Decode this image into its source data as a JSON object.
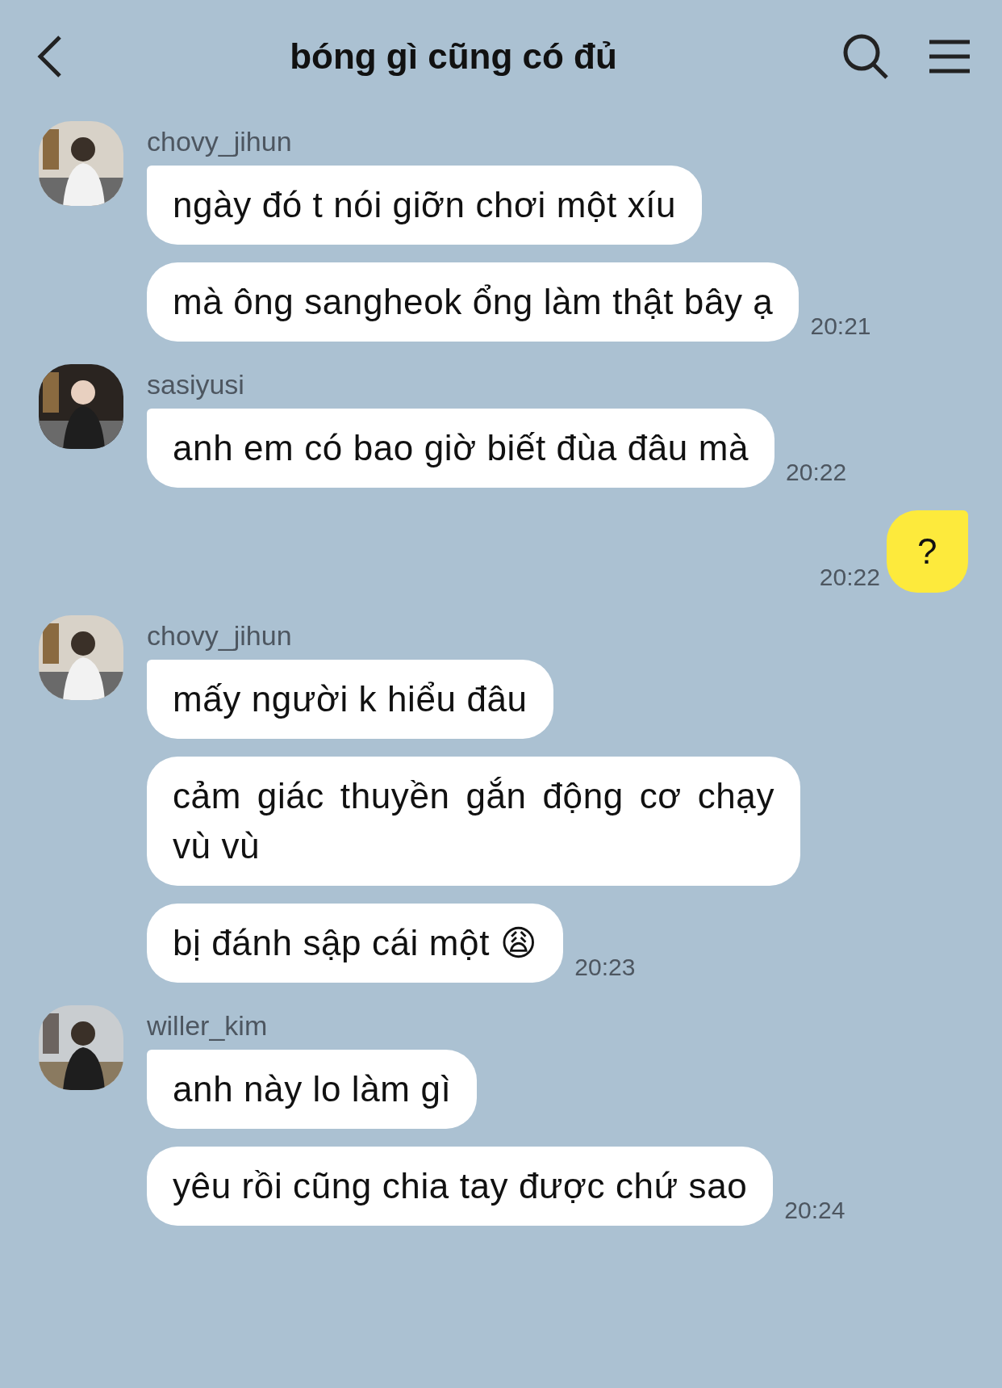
{
  "header": {
    "title": "bóng gì cũng có đủ"
  },
  "messages": [
    {
      "kind": "group",
      "sender": "chovy_jihun",
      "bubbles": [
        "ngày đó t nói giỡn chơi một xíu",
        "mà ông sangheok ổng làm thật bây ạ"
      ],
      "time": "20:21"
    },
    {
      "kind": "group",
      "sender": "sasiyusi",
      "bubbles": [
        "anh em có bao giờ biết đùa đâu mà"
      ],
      "time": "20:22"
    },
    {
      "kind": "own",
      "text": "?",
      "time": "20:22"
    },
    {
      "kind": "group",
      "sender": "chovy_jihun",
      "bubbles": [
        "mấy người k hiểu đâu",
        "cảm giác thuyền gắn động cơ chạy vù vù",
        "bị đánh sập cái một 😩"
      ],
      "time": "20:23"
    },
    {
      "kind": "group",
      "sender": "willer_kim",
      "bubbles": [
        "anh này lo làm gì",
        "yêu rồi cũng chia tay được chứ sao"
      ],
      "time": "20:24"
    }
  ]
}
